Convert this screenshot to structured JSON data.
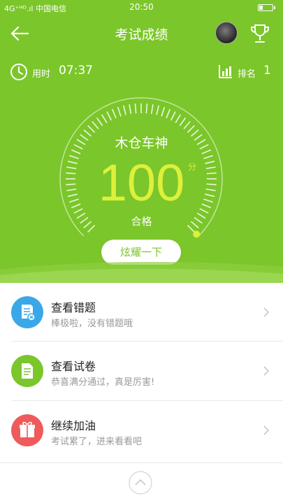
{
  "status": {
    "carrier": "4G⁺ᴴᴰ.ıl 中国电信",
    "time": "20:50"
  },
  "nav": {
    "title": "考试成绩"
  },
  "info": {
    "used_label": "用时",
    "used_value": "07:37",
    "rank_label": "排名",
    "rank_value": "1"
  },
  "result": {
    "name": "木仓车神",
    "score": "100",
    "unit": "分",
    "status": "合格",
    "share_label": "炫耀一下",
    "progress": 1.0
  },
  "list": [
    {
      "title": "查看错题",
      "subtitle": "棒极啦，没有错题哦",
      "icon": "wrong-answers-icon",
      "color": "#3aa8e8"
    },
    {
      "title": "查看试卷",
      "subtitle": "恭喜满分通过，真是厉害!",
      "icon": "paper-icon",
      "color": "#7bc62a"
    },
    {
      "title": "继续加油",
      "subtitle": "考试累了，进来看看吧",
      "icon": "gift-icon",
      "color": "#ef5b5b"
    }
  ],
  "colors": {
    "primary": "#7bc62a",
    "score": "#ddf03a",
    "blue": "#3aa8e8",
    "red": "#ef5b5b"
  }
}
